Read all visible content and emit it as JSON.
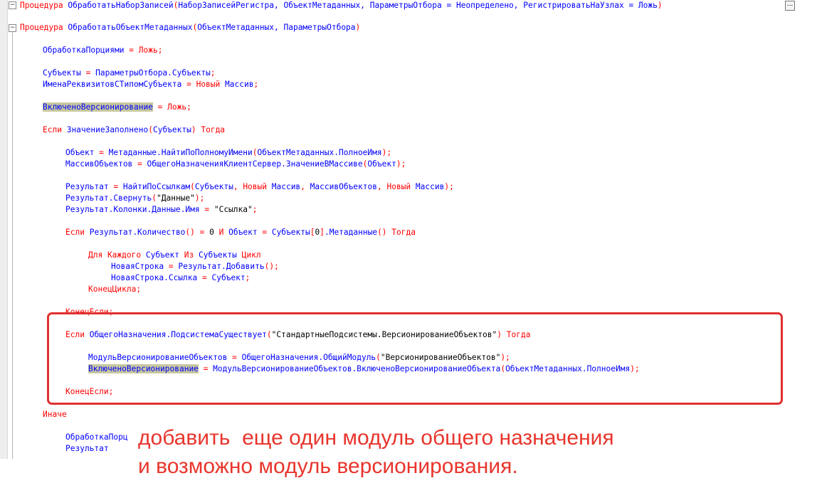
{
  "more_button": "...",
  "proc1": {
    "kw": "Процедура",
    "name": "ОбработатьНаборЗаписей",
    "params": "НаборЗаписейРегистра, ОбъектМетаданных, ПараметрыОтбора = Неопределено, РегистрироватьНаУзлах = Ложь"
  },
  "proc2": {
    "kw": "Процедура",
    "name": "ОбработатьОбъектМетаданных",
    "params": "ОбъектМетаданных, ПараметрыОтбора"
  },
  "l_batch": {
    "a": "ОбработкаПорциями",
    "b": "Ложь"
  },
  "l_subj": {
    "a": "Субъекты",
    "b": "ПараметрыОтбора.Субъекты"
  },
  "l_names": {
    "a": "ИменаРеквизитовСТипомСубъекта",
    "b": "Новый",
    "c": "Массив"
  },
  "l_vers": {
    "a": "ВключеноВерсионирование",
    "b": "Ложь"
  },
  "l_if1": {
    "a": "Если",
    "b": "ЗначениеЗаполнено",
    "c": "Субъекты",
    "d": "Тогда"
  },
  "l_obj": {
    "a": "Объект",
    "b": "Метаданные.НайтиПоПолномуИмени",
    "c": "ОбъектМетаданных.ПолноеИмя"
  },
  "l_arr": {
    "a": "МассивОбъектов",
    "b": "ОбщегоНазначенияКлиентСервер.ЗначениеВМассиве",
    "c": "Объект"
  },
  "l_res1": {
    "a": "Результат",
    "b": "НайтиПоСсылкам",
    "c": "Субъекты",
    "d": "Новый",
    "e": "Массив",
    "f": "МассивОбъектов",
    "g": "Новый",
    "h": "Массив"
  },
  "l_res2": {
    "a": "Результат.Свернуть",
    "b": "\"Данные\""
  },
  "l_res3": {
    "a": "Результат.Колонки.Данные.Имя",
    "b": "\"Ссылка\""
  },
  "l_if2": {
    "a": "Если",
    "b": "Результат.Количество",
    "c": "0",
    "d": "И",
    "e": "Объект",
    "f": "Субъекты",
    "g": "0",
    "h": ".Метаданные",
    "i": "Тогда"
  },
  "l_for": {
    "a": "Для Каждого",
    "b": "Субъект",
    "c": "Из",
    "d": "Субъекты",
    "e": "Цикл"
  },
  "l_new1": {
    "a": "НоваяСтрока",
    "b": "Результат.Добавить"
  },
  "l_new2": {
    "a": "НоваяСтрока.Ссылка",
    "b": "Субъект"
  },
  "l_endfor": "КонецЦикла;",
  "l_endif1": "КонецЕсли;",
  "l_if3": {
    "a": "Если",
    "b": "ОбщегоНазначения.ПодсистемаСуществует",
    "c": "\"СтандартныеПодсистемы.ВерсионированиеОбъектов\"",
    "d": "Тогда"
  },
  "l_mod": {
    "a": "МодульВерсионированиеОбъектов",
    "b": "ОбщегоНазначения.ОбщийМодуль",
    "c": "\"ВерсионированиеОбъектов\""
  },
  "l_vers2": {
    "a": "ВключеноВерсионирование",
    "b": "МодульВерсионированиеОбъектов.ВключеноВерсионированиеОбъекта",
    "c": "ОбъектМетаданных.ПолноеИмя"
  },
  "l_endif2": "КонецЕсли;",
  "l_else": "Иначе",
  "l_batch2": "ОбработкаПорц",
  "l_res4": "Результат",
  "note": {
    "line1": "добавить  еще один модуль общего назначения",
    "line2": "и возможно модуль версионирования."
  },
  "colors": {
    "keyword": "#ff0000",
    "identifier": "#0000ff",
    "string": "#000000",
    "highlight": "#c8c8a0",
    "annotation": "#e8352c"
  }
}
